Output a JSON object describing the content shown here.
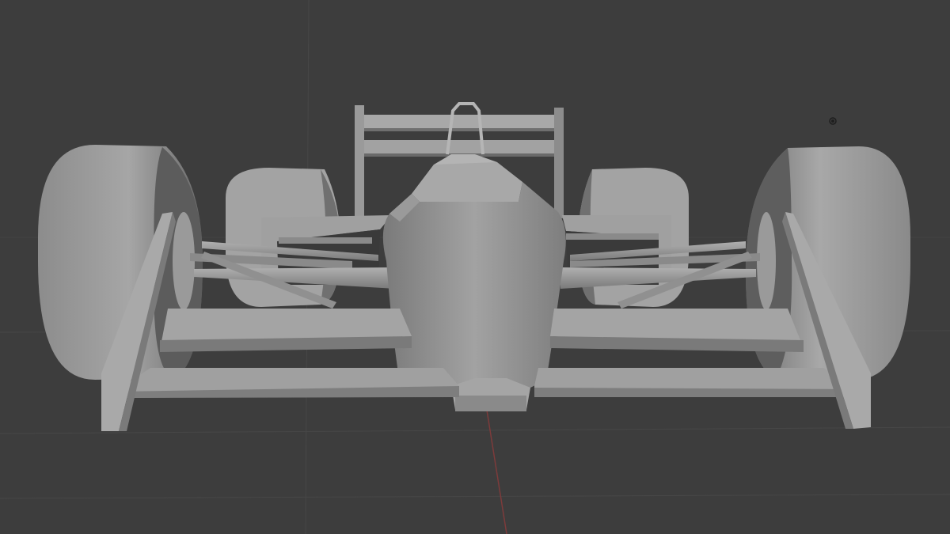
{
  "viewport": {
    "mode": "3d-viewport",
    "shading": "solid",
    "background_color": "#3d3d3d",
    "grid_color": "#4a4a4a",
    "x_axis_color": "#8a3a3a",
    "model_base_color": "#8f8f8f",
    "model_light_color": "#b8b8b8",
    "model_dark_color": "#5e5e5e",
    "scene_object": "race-car-front-view"
  },
  "gizmo": {
    "icon": "light-object-icon"
  }
}
